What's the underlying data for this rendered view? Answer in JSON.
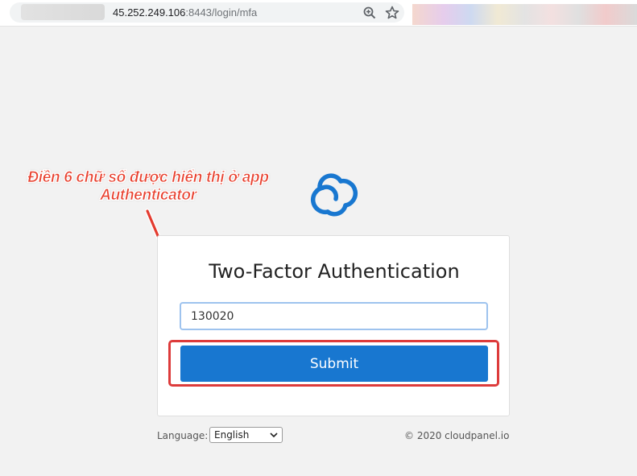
{
  "browser": {
    "url_host": "45.252.249.106",
    "url_path": ":8443/login/mfa",
    "icons": [
      "zoom-icon",
      "star-icon"
    ]
  },
  "annotation": {
    "line1": "Điền 6 chữ số được hiển thị ở app",
    "line2": "Authenticator",
    "color": "#e8412f"
  },
  "brand": {
    "logo_icon": "cloud-logo-icon",
    "accent": "#1877d0"
  },
  "mfa": {
    "title": "Two-Factor Authentication",
    "code_value": "130020",
    "submit_label": "Submit",
    "highlight_color": "#dd3b3b"
  },
  "footer": {
    "language_label": "Language:",
    "language_value": "English",
    "copyright": "© 2020 cloudpanel.io"
  }
}
